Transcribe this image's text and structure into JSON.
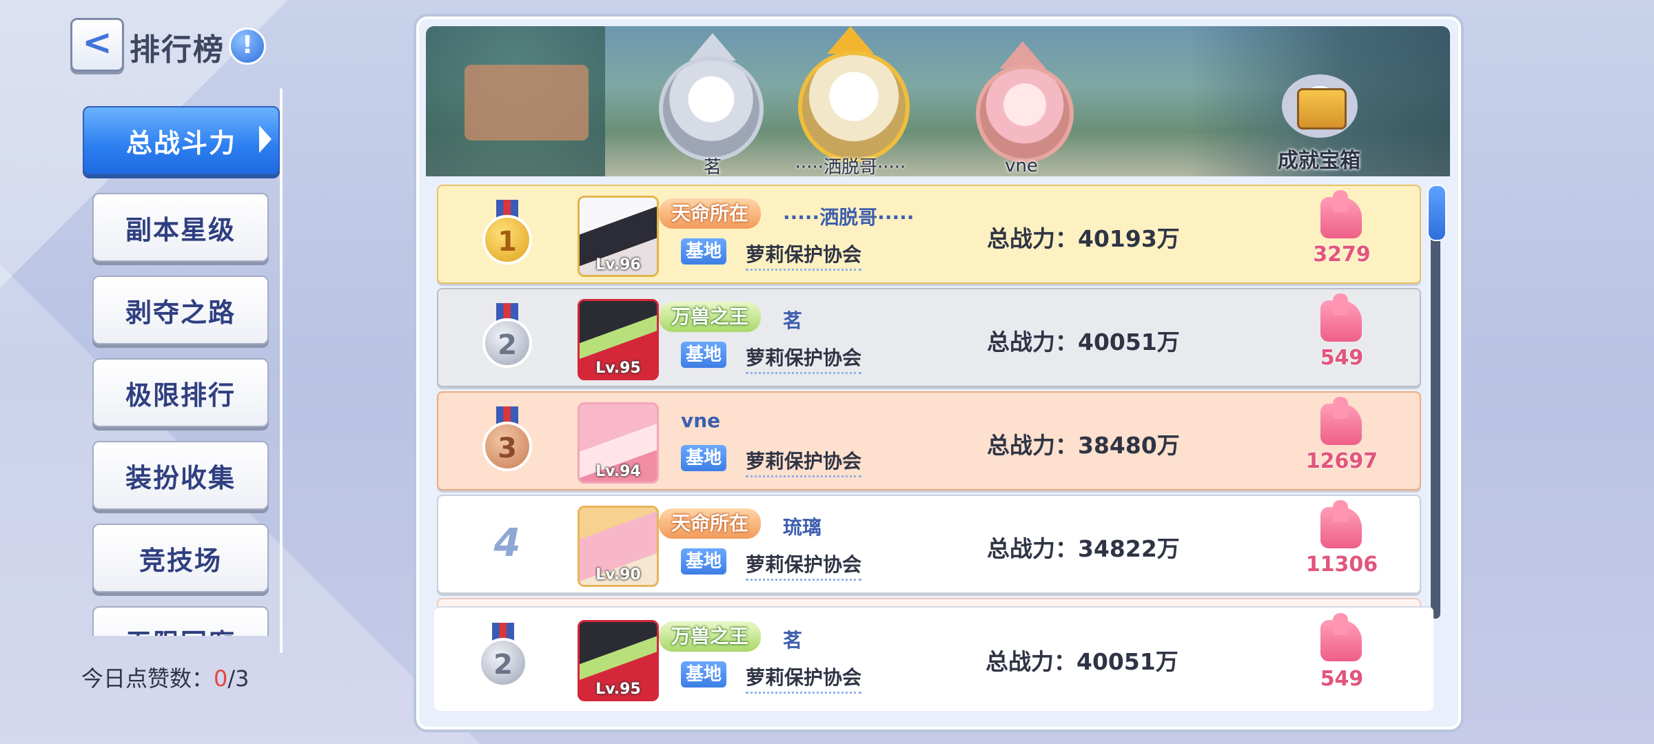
{
  "header": {
    "title": "排行榜",
    "back_label": "<",
    "info_label": "!"
  },
  "sidebar": {
    "tabs": [
      {
        "label": "总战斗力",
        "active": true
      },
      {
        "label": "副本星级",
        "active": false
      },
      {
        "label": "剥夺之路",
        "active": false
      },
      {
        "label": "极限排行",
        "active": false
      },
      {
        "label": "装扮收集",
        "active": false
      },
      {
        "label": "竞技场",
        "active": false
      },
      {
        "label": "无限回廊",
        "active": false
      }
    ],
    "like_label": "今日点赞数：",
    "like_used": "0",
    "like_total": "/3"
  },
  "podium": {
    "first": {
      "name": "·····洒脱哥·····"
    },
    "second": {
      "name": "茗"
    },
    "third": {
      "name": "vne"
    },
    "chest_label": "成就宝箱"
  },
  "rows": [
    {
      "rank": "1",
      "level": "Lv.96",
      "title": "天命所在",
      "name": "·····洒脱哥·····",
      "guild_tag": "基地",
      "guild": "萝莉保护协会",
      "power": "总战力：40193万",
      "likes": "3279"
    },
    {
      "rank": "2",
      "level": "Lv.95",
      "title": "万兽之王",
      "name": "茗",
      "guild_tag": "基地",
      "guild": "萝莉保护协会",
      "power": "总战力：40051万",
      "likes": "549"
    },
    {
      "rank": "3",
      "level": "Lv.94",
      "title": "",
      "name": "vne",
      "guild_tag": "基地",
      "guild": "萝莉保护协会",
      "power": "总战力：38480万",
      "likes": "12697"
    },
    {
      "rank": "4",
      "level": "Lv.90",
      "title": "天命所在",
      "name": "琉璃",
      "guild_tag": "基地",
      "guild": "萝莉保护协会",
      "power": "总战力：34822万",
      "likes": "11306"
    }
  ],
  "my_row": {
    "rank": "2",
    "level": "Lv.95",
    "title": "万兽之王",
    "name": "茗",
    "guild_tag": "基地",
    "guild": "萝莉保护协会",
    "power": "总战力：40051万",
    "likes": "549"
  },
  "colors": {
    "accent": "#2c7ef0",
    "like": "#e2557d",
    "gold_row": "#fdf1c2",
    "bronze_row": "#fde0cd"
  }
}
